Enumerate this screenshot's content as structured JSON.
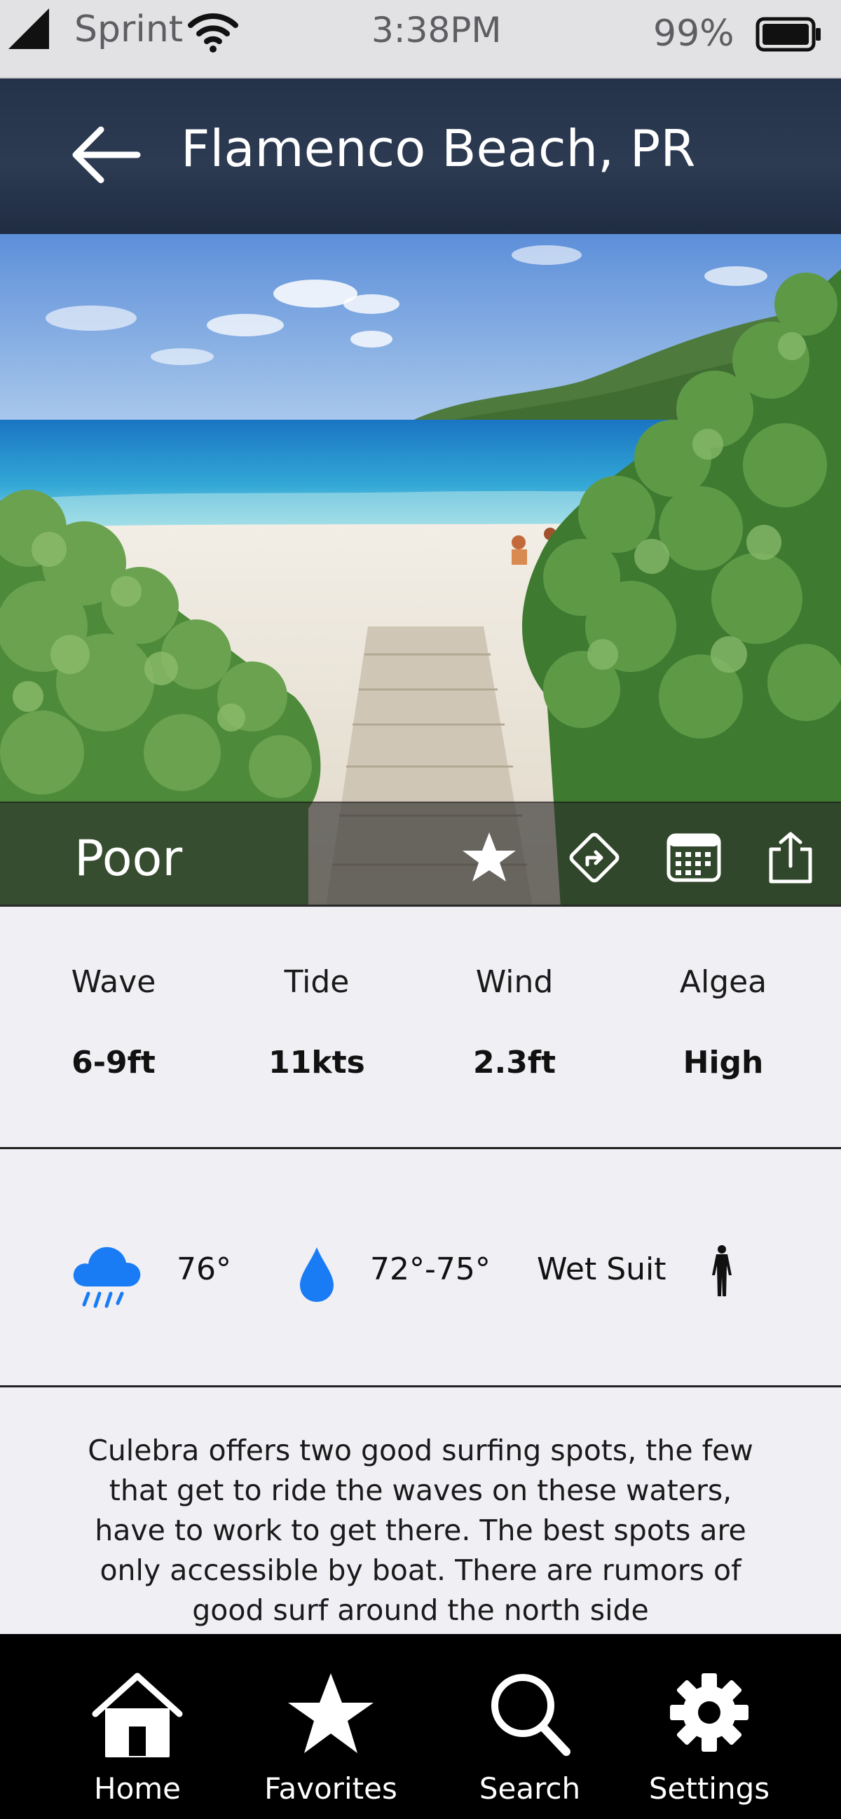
{
  "status_bar": {
    "carrier": "Sprint",
    "time": "3:38PM",
    "battery": "99%",
    "icons": [
      "signal-icon",
      "wifi-icon",
      "battery-icon"
    ]
  },
  "header": {
    "title": "Flamenco Beach, PR",
    "back_icon": "arrow-left-icon"
  },
  "hero": {
    "rating": "Poor",
    "actions": [
      "star-icon",
      "directions-icon",
      "calendar-icon",
      "share-icon"
    ]
  },
  "conditions": {
    "items": [
      {
        "label": "Wave",
        "value": "6-9ft"
      },
      {
        "label": "Tide",
        "value": "11kts"
      },
      {
        "label": "Wind",
        "value": "2.3ft"
      },
      {
        "label": "Algea",
        "value": "High"
      }
    ]
  },
  "weather": {
    "air_temp": "76°",
    "water_temp": "72°-75°",
    "suit": "Wet Suit",
    "icons": [
      "rain-cloud-icon",
      "water-drop-icon",
      "wetsuit-icon"
    ],
    "accent_color": "#1a7cf5"
  },
  "description": {
    "text": "Culebra offers two good surfing spots, the few that get to ride the waves on these waters, have to work to get there. The best spots are only accessible by boat. There are rumors of good surf around the north side"
  },
  "tabbar": {
    "items": [
      {
        "label": "Home",
        "icon": "home-icon"
      },
      {
        "label": "Favorites",
        "icon": "star-icon"
      },
      {
        "label": "Search",
        "icon": "search-icon"
      },
      {
        "label": "Settings",
        "icon": "gear-icon"
      }
    ]
  }
}
